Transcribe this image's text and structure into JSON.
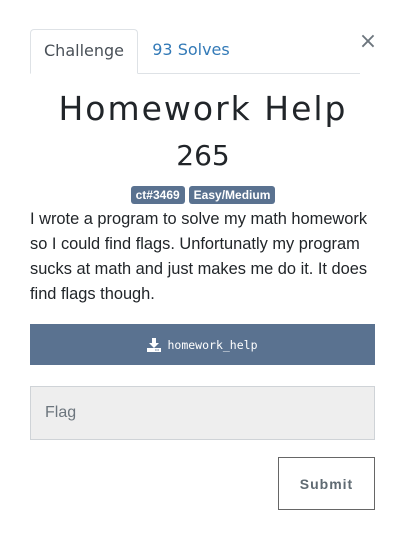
{
  "tabs": {
    "challenge_label": "Challenge",
    "solves_label": "93 Solves"
  },
  "close_glyph": "×",
  "challenge": {
    "title": "Homework Help",
    "points": "265",
    "tags": [
      "ct#3469",
      "Easy/Medium"
    ],
    "description": "I wrote a program to solve my math homework so I could find flags. Unfortunatly my program sucks at math and just makes me do it. It does find flags though.",
    "file_name": "homework_help"
  },
  "flag_input": {
    "placeholder": "Flag",
    "value": ""
  },
  "submit_label": "Submit",
  "colors": {
    "badge": "#5a7290",
    "download_button": "#5a7290",
    "link": "#337ab7"
  },
  "icons": {
    "download": "download-icon",
    "close": "close-icon"
  }
}
